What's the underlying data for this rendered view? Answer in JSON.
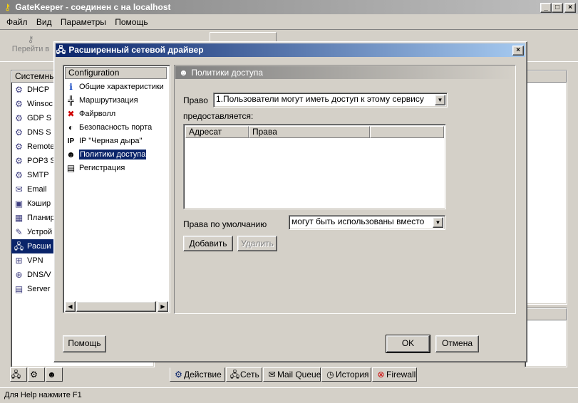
{
  "window": {
    "title": "GateKeeper - соединен с на localhost"
  },
  "menu": [
    "Файл",
    "Вид",
    "Параметры",
    "Помощь"
  ],
  "toolbar": {
    "first_label": "Перейти в"
  },
  "left_panel": {
    "header": "Системны",
    "items": [
      {
        "icon": "dhcp-icon",
        "label": "DHCP"
      },
      {
        "icon": "winsock-icon",
        "label": "Winsoc"
      },
      {
        "icon": "gdp-icon",
        "label": "GDP S"
      },
      {
        "icon": "dns-icon",
        "label": "DNS S"
      },
      {
        "icon": "remote-icon",
        "label": "Remote"
      },
      {
        "icon": "pop3-icon",
        "label": "POP3 S"
      },
      {
        "icon": "smtp-icon",
        "label": "SMTP"
      },
      {
        "icon": "email-icon",
        "label": "Email"
      },
      {
        "icon": "cache-icon",
        "label": "Кэшир"
      },
      {
        "icon": "scheduler-icon",
        "label": "Планир"
      },
      {
        "icon": "devices-icon",
        "label": "Устрой"
      },
      {
        "icon": "network-driver-icon",
        "label": "Расши"
      },
      {
        "icon": "vpn-icon",
        "label": "VPN"
      },
      {
        "icon": "dns-wins-icon",
        "label": "DNS/V"
      },
      {
        "icon": "server-icon",
        "label": "Server"
      }
    ],
    "selected_index": 11
  },
  "bottom_tabs": [
    "Действие",
    "Сеть",
    "Mail Queue",
    "История",
    "Firewall"
  ],
  "status_bar": "Для Help нажмите F1",
  "dialog": {
    "title": "Расширенный сетевой драйвер",
    "tree": {
      "header": "Configuration",
      "items": [
        {
          "icon": "info-icon",
          "label": "Общие характеристики"
        },
        {
          "icon": "routing-icon",
          "label": "Маршрутизация"
        },
        {
          "icon": "firewall-icon",
          "label": "Файрволл"
        },
        {
          "icon": "port-security-icon",
          "label": "Безопасность порта"
        },
        {
          "icon": "ip-blackhole-icon",
          "label": "IP \"Черная дыра\""
        },
        {
          "icon": "access-policy-icon",
          "label": "Политики доступа"
        },
        {
          "icon": "registration-icon",
          "label": "Регистрация"
        }
      ],
      "selected_index": 5
    },
    "panel": {
      "title": "Политики доступа",
      "right_label": "Право",
      "right_value": "1.Пользователи могут иметь доступ к этому сервису",
      "granted_label": "предоставляется:",
      "columns": [
        "Адресат",
        "Права"
      ],
      "default_label": "Права по умолчанию",
      "default_value": "могут быть использованы вместо",
      "add_button": "Добавить",
      "delete_button": "Удалить"
    },
    "help_button": "Помощь",
    "ok_button": "OK",
    "cancel_button": "Отмена"
  }
}
